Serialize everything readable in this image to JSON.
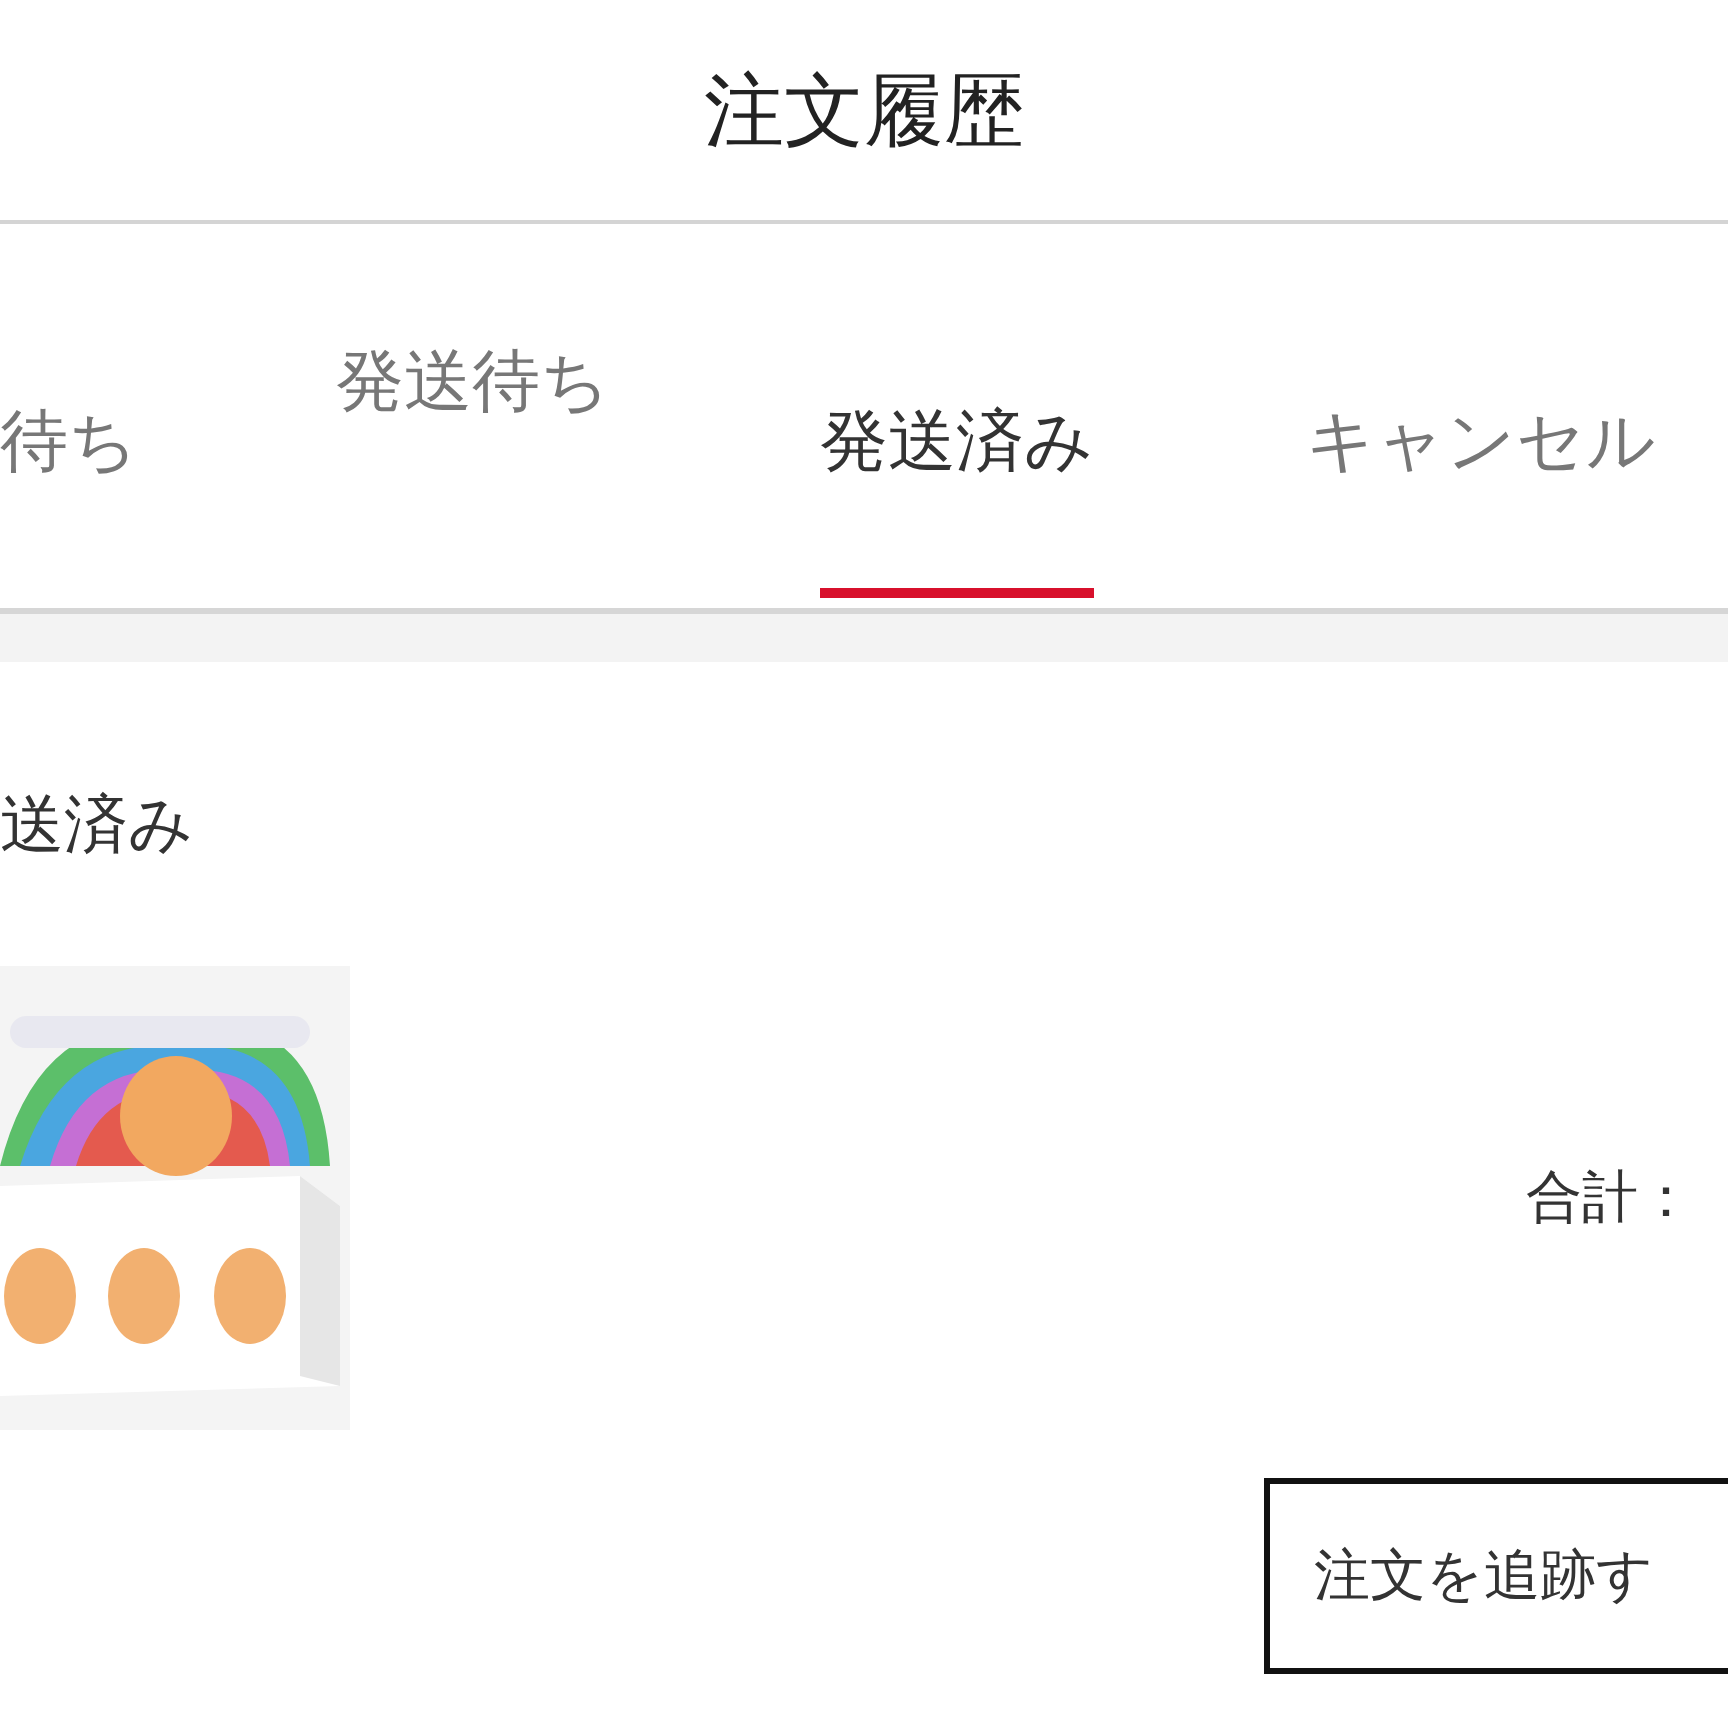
{
  "header": {
    "title": "注文履歴"
  },
  "tabs": [
    {
      "label": "待ち",
      "selected": false,
      "raised": false
    },
    {
      "label": "発送待ち",
      "selected": false,
      "raised": true
    },
    {
      "label": "発送済み",
      "selected": true,
      "raised": false
    },
    {
      "label": "キャンセル",
      "selected": false,
      "raised": false
    }
  ],
  "order": {
    "status": "送済み",
    "total_label": "合計：",
    "track_button": "注文を追跡す"
  }
}
